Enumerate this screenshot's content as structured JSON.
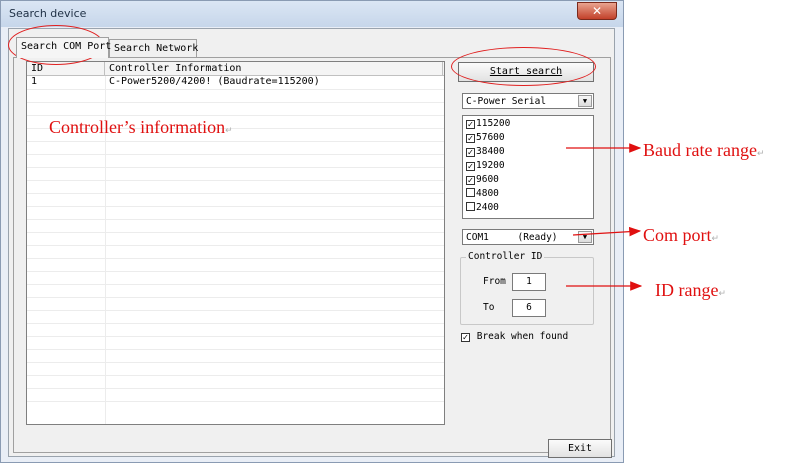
{
  "window": {
    "title": "Search device",
    "close_glyph": "✕"
  },
  "tabs": [
    {
      "label": "Search COM Port",
      "active": true
    },
    {
      "label": "Search Network",
      "active": false
    }
  ],
  "table": {
    "headers": [
      "ID",
      "Controller Information"
    ],
    "rows": [
      {
        "id": "1",
        "info": "C-Power5200/4200! (Baudrate=115200)"
      }
    ]
  },
  "controls": {
    "start_search_label": "Start search",
    "protocol_select_value": "C-Power Serial",
    "baud_rates": [
      {
        "label": "115200",
        "checked": true
      },
      {
        "label": "57600",
        "checked": true
      },
      {
        "label": "38400",
        "checked": true
      },
      {
        "label": "19200",
        "checked": true
      },
      {
        "label": "9600",
        "checked": true
      },
      {
        "label": "4800",
        "checked": false
      },
      {
        "label": "2400",
        "checked": false
      }
    ],
    "com_port_value": "COM1     (Ready)",
    "controller_id": {
      "group_title": "Controller ID",
      "from_label": "From",
      "from_value": "1",
      "to_label": "To",
      "to_value": "6"
    },
    "break_when_found_label": "Break when found",
    "break_when_found_checked": true,
    "exit_label": "Exit"
  },
  "annotations": {
    "controller_info": "Controller’s information",
    "baud_rate_range": "Baud rate range",
    "com_port": "Com port",
    "id_range": "ID range",
    "return_mark": "↵"
  },
  "colors": {
    "annotation_red": "#e01010",
    "window_frame": "#c6d6ea",
    "close_button": "#c2402a"
  }
}
